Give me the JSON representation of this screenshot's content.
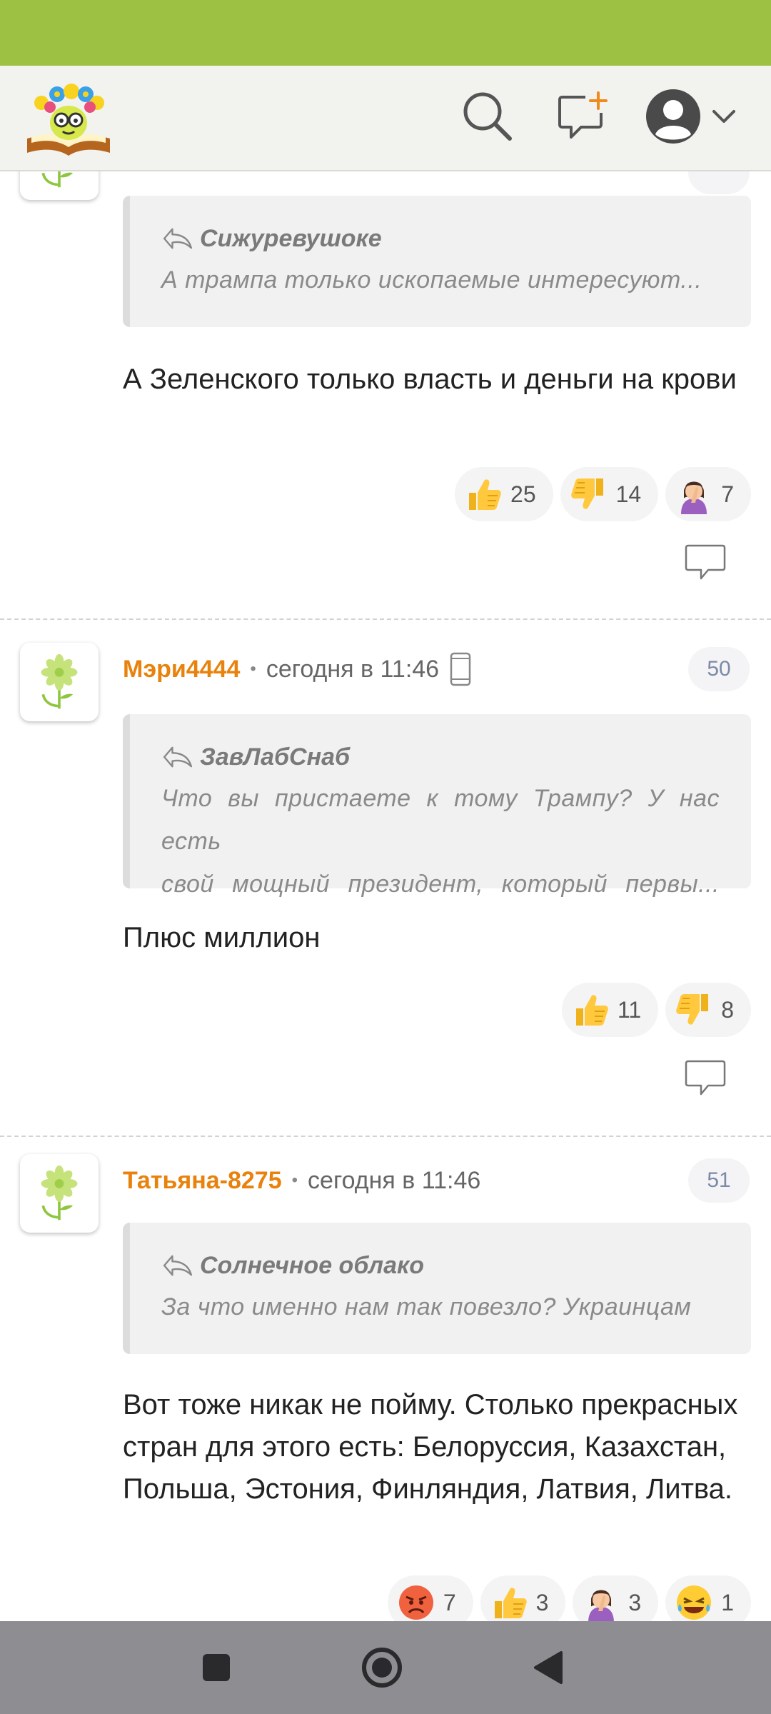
{
  "app": {
    "logo": "book-flower-logo"
  },
  "header": {
    "icons": [
      "search-icon",
      "new-comment-icon",
      "user-avatar-icon",
      "chevron-down-icon"
    ]
  },
  "comments": [
    {
      "quote": {
        "author": "Сижуревушоке",
        "text": "А трампа только ископаемые интересуют..."
      },
      "text": "А Зеленского только власть и деньги на крови",
      "reactions": [
        {
          "emoji": "thumbs-up",
          "count": "25"
        },
        {
          "emoji": "thumbs-down",
          "count": "14"
        },
        {
          "emoji": "facepalm",
          "count": "7"
        }
      ]
    },
    {
      "author": "Мэри4444",
      "time": "сегодня в 11:46",
      "number": "50",
      "quote": {
        "author": "ЗавЛабСнаб",
        "line1": "Что вы пристаете к тому Трампу? У нас есть",
        "line2": "свой мощный президент, который первы..."
      },
      "text": "Плюс миллион",
      "reactions": [
        {
          "emoji": "thumbs-up",
          "count": "11"
        },
        {
          "emoji": "thumbs-down",
          "count": "8"
        }
      ]
    },
    {
      "author": "Татьяна-8275",
      "time": "сегодня в 11:46",
      "number": "51",
      "quote": {
        "author": "Солнечное облако",
        "text": "За что именно нам так повезло? Украинцам"
      },
      "text": "Вот тоже никак не пойму. Столько прекрасных стран для этого есть: Белоруссия, Казахстан, Польша, Эстония, Финляндия, Латвия, Литва.",
      "reactions": [
        {
          "emoji": "angry",
          "count": "7"
        },
        {
          "emoji": "thumbs-up",
          "count": "3"
        },
        {
          "emoji": "facepalm",
          "count": "3"
        },
        {
          "emoji": "laughing",
          "count": "1"
        }
      ]
    }
  ],
  "colors": {
    "status_bar": "#9dc142",
    "author": "#e8820c",
    "nav_bar": "#8e8e92"
  }
}
